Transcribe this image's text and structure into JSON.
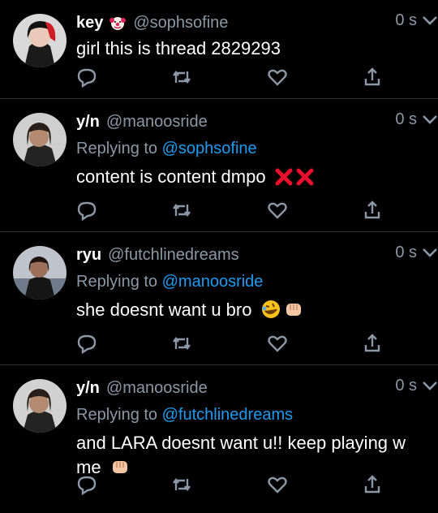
{
  "tweets": [
    {
      "name": "key",
      "handle": "@sophsofine",
      "time": "0 s",
      "reply_prefix": "",
      "reply_to": "",
      "text": "girl this is thread 2829293",
      "badge_icon": "clown-emoji-icon"
    },
    {
      "name": "y/n",
      "handle": "@manoosride",
      "time": "0 s",
      "reply_prefix": "Replying to",
      "reply_to": "@sophsofine",
      "text": "content is content dmpo",
      "trailing_icons": [
        "cross-mark-icon",
        "cross-mark-icon"
      ]
    },
    {
      "name": "ryu",
      "handle": "@futchlinedreams",
      "time": "0 s",
      "reply_prefix": "Replying to",
      "reply_to": "@manoosride",
      "text": "she doesnt want u bro",
      "trailing_icons": [
        "rofl-emoji-icon",
        "fist-emoji-icon"
      ]
    },
    {
      "name": "y/n",
      "handle": "@manoosride",
      "time": "0 s",
      "reply_prefix": "Replying to",
      "reply_to": "@futchlinedreams",
      "text": "and LARA doesnt want u!! keep playing w me",
      "trailing_icons": [
        "fist-emoji-icon"
      ]
    }
  ],
  "colors": {
    "background": "#000000",
    "muted": "#8b98a5",
    "link": "#1d9bf0",
    "divider": "#2f3336"
  }
}
